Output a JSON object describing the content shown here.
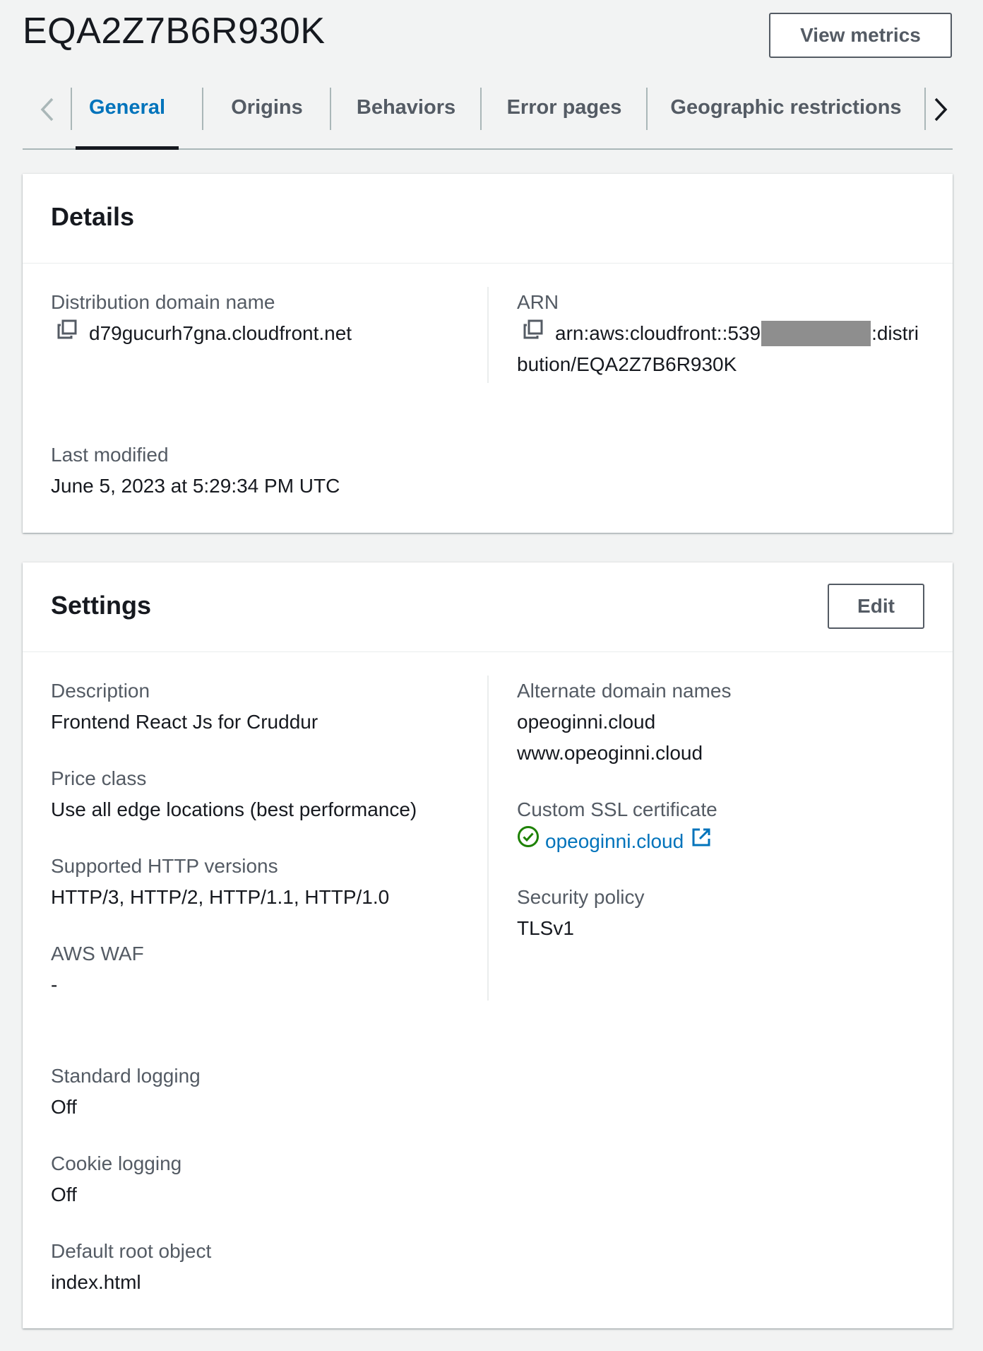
{
  "header": {
    "title": "EQA2Z7B6R930K",
    "view_metrics_label": "View metrics"
  },
  "tabs": [
    {
      "label": "General",
      "active": true
    },
    {
      "label": "Origins",
      "active": false
    },
    {
      "label": "Behaviors",
      "active": false
    },
    {
      "label": "Error pages",
      "active": false
    },
    {
      "label": "Geographic restrictions",
      "active": false
    }
  ],
  "icons": {
    "tab_prev": "chevron-left-icon",
    "tab_next": "chevron-right-icon",
    "copy": "copy-icon",
    "status_ok": "check-circle-icon",
    "external": "external-link-icon"
  },
  "colors": {
    "accent": "#0073bb",
    "success": "#1d8102",
    "background": "#f2f3f3"
  },
  "details": {
    "title": "Details",
    "distribution_domain_label": "Distribution domain name",
    "distribution_domain_value": "d79gucurh7gna.cloudfront.net",
    "arn_label": "ARN",
    "arn_prefix": "arn:aws:cloudfront::539",
    "arn_suffix_line1": ":distri",
    "arn_line2": "bution/EQA2Z7B6R930K",
    "last_modified_label": "Last modified",
    "last_modified_value": "June 5, 2023 at 5:29:34 PM UTC"
  },
  "settings": {
    "title": "Settings",
    "edit_label": "Edit",
    "description_label": "Description",
    "description_value": "Frontend React Js for Cruddur",
    "price_class_label": "Price class",
    "price_class_value": "Use all edge locations (best performance)",
    "http_versions_label": "Supported HTTP versions",
    "http_versions_value": "HTTP/3, HTTP/2, HTTP/1.1, HTTP/1.0",
    "waf_label": "AWS WAF",
    "waf_value": "-",
    "alt_domains_label": "Alternate domain names",
    "alt_domains": [
      "opeoginni.cloud",
      "www.opeoginni.cloud"
    ],
    "ssl_label": "Custom SSL certificate",
    "ssl_value": "opeoginni.cloud",
    "security_policy_label": "Security policy",
    "security_policy_value": "TLSv1",
    "standard_logging_label": "Standard logging",
    "standard_logging_value": "Off",
    "cookie_logging_label": "Cookie logging",
    "cookie_logging_value": "Off",
    "default_root_label": "Default root object",
    "default_root_value": "index.html"
  }
}
